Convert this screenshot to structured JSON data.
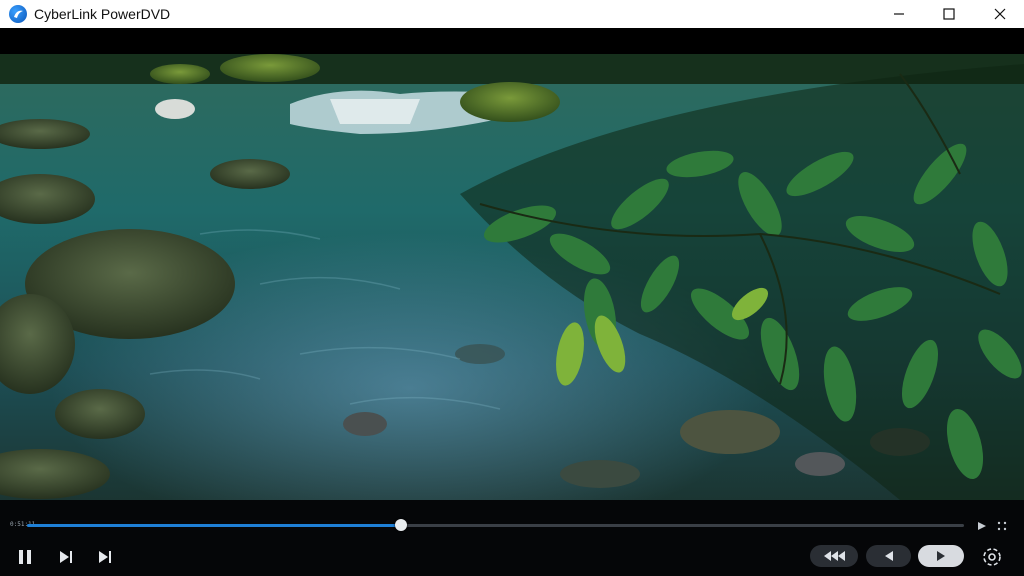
{
  "window": {
    "title": "CyberLink PowerDVD",
    "controls": {
      "minimize": "minimize-icon",
      "maximize": "maximize-icon",
      "close": "close-icon"
    }
  },
  "player": {
    "elapsed_time": "0:51:11",
    "progress": 0.399,
    "buttons": {
      "pause": "pause-icon",
      "step_forward": "step-forward-icon",
      "next_chapter": "next-chapter-icon",
      "rewind": "rewind-icon",
      "previous": "previous-icon",
      "play": "play-icon",
      "settings": "settings-icon",
      "bookmark_next": "bookmark-next-icon",
      "more": "more-options-icon"
    },
    "colors": {
      "progress_fill": "#1e7fd6",
      "track": "#3a3f46",
      "play_pill": "#d8dbe0"
    }
  }
}
